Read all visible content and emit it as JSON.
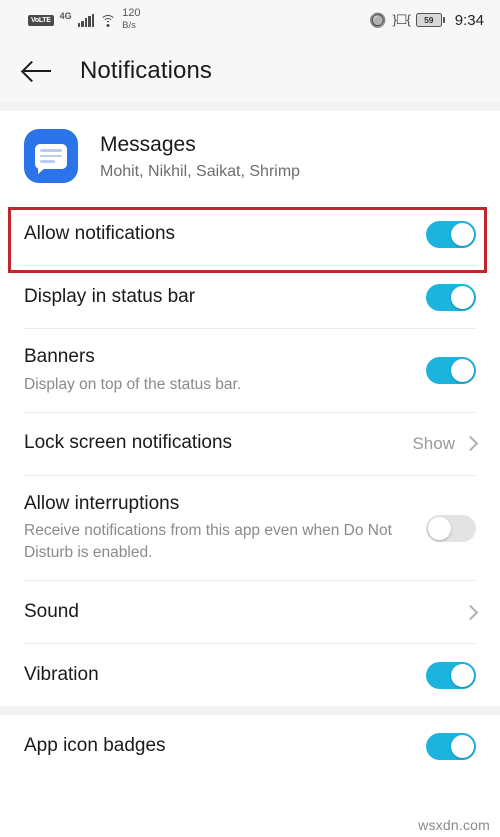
{
  "statusbar": {
    "volte": "VoLTE",
    "network": "4G",
    "wifi_icon": "wifi-icon",
    "data_speed_value": "120",
    "data_speed_unit": "B/s",
    "bluetooth_icon": "bluetooth-icon",
    "vibrate_icon": "vibrate-icon",
    "battery_percent": "59",
    "time": "9:34"
  },
  "header": {
    "back_icon": "back-arrow-icon",
    "title": "Notifications"
  },
  "app": {
    "icon": "messages-app-icon",
    "name": "Messages",
    "subtitle": "Mohit, Nikhil, Saikat, Shrimp"
  },
  "settings": [
    {
      "title": "Allow notifications",
      "subtitle": "",
      "control": "toggle",
      "state": "on",
      "highlighted": true
    },
    {
      "title": "Display in status bar",
      "subtitle": "",
      "control": "toggle",
      "state": "on",
      "highlighted": false
    },
    {
      "title": "Banners",
      "subtitle": "Display on top of the status bar.",
      "control": "toggle",
      "state": "on",
      "highlighted": false
    },
    {
      "title": "Lock screen notifications",
      "subtitle": "",
      "control": "value",
      "value": "Show",
      "highlighted": false
    },
    {
      "title": "Allow interruptions",
      "subtitle": "Receive notifications from this app even when Do Not Disturb is enabled.",
      "control": "toggle",
      "state": "off",
      "highlighted": false
    },
    {
      "title": "Sound",
      "subtitle": "",
      "control": "chevron",
      "highlighted": false
    },
    {
      "title": "Vibration",
      "subtitle": "",
      "control": "toggle",
      "state": "on",
      "highlighted": false
    }
  ],
  "settings_section2": [
    {
      "title": "App icon badges",
      "subtitle": "",
      "control": "toggle",
      "state": "on",
      "highlighted": false
    }
  ],
  "watermark": "wsxdn.com",
  "colors": {
    "toggle_on": "#1cb4dc",
    "toggle_off": "#e3e3e3",
    "app_icon_blue": "#2a73e8",
    "highlight_red": "#c0272d",
    "bar_background": "#f7f7f7"
  }
}
